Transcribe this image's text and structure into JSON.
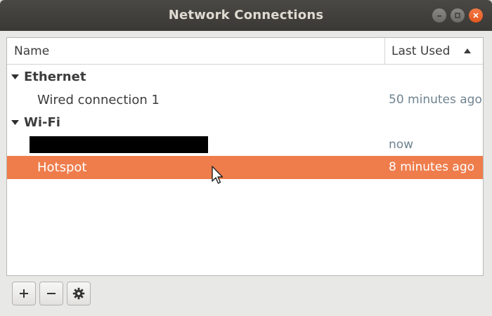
{
  "window": {
    "title": "Network Connections",
    "controls": [
      "minimize-icon",
      "maximize-icon",
      "close-icon"
    ],
    "close_color": "#e95420"
  },
  "columns": {
    "name": "Name",
    "last_used": "Last Used",
    "sort_indicator": "sort-ascending-icon"
  },
  "groups": [
    {
      "label": "Ethernet",
      "connections": [
        {
          "name": "Wired connection 1",
          "last_used": "50 minutes ago"
        }
      ]
    },
    {
      "label": "Wi-Fi",
      "connections": [
        {
          "name": "",
          "redacted": true,
          "last_used": "now"
        },
        {
          "name": "Hotspot",
          "last_used": "8 minutes ago",
          "selected": true
        }
      ]
    }
  ],
  "selection_color": "#ef7d4c",
  "toolbar": {
    "add": "+",
    "remove": "−",
    "settings_icon": "gear-icon"
  }
}
